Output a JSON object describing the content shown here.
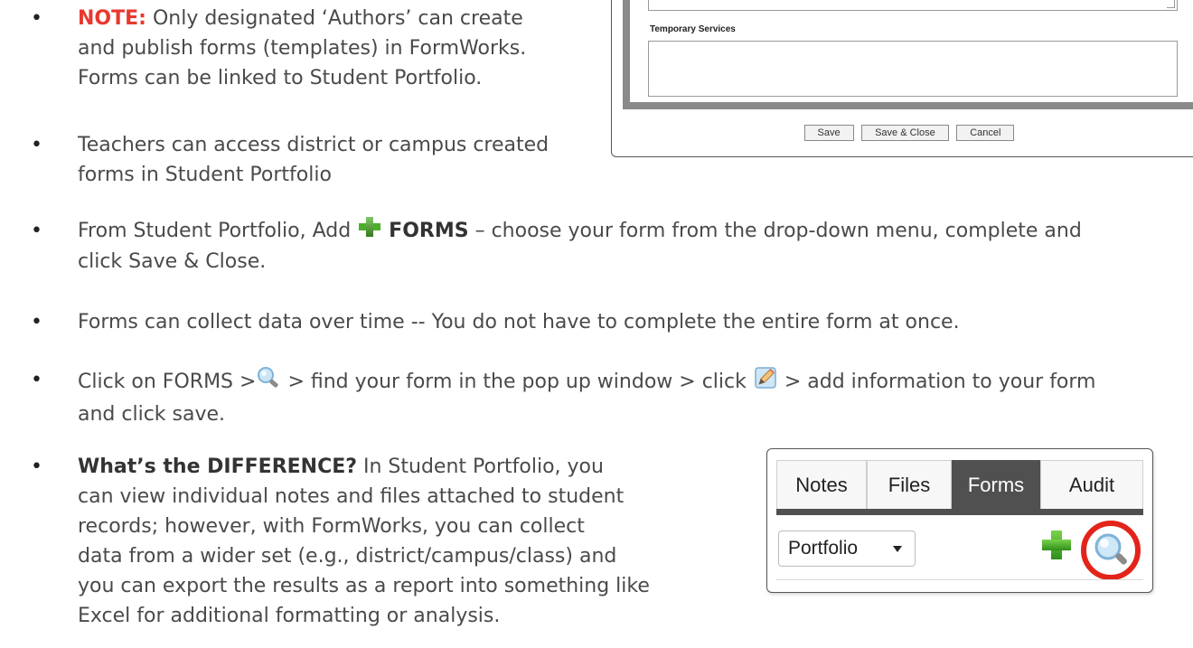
{
  "bullets": [
    {
      "id": "note",
      "bold_prefix": "NOTE:",
      "line1": " Only designated ‘Authors’ can create",
      "line2": "and publish forms (templates) in FormWorks.",
      "line3": "Forms can be linked to Student Portfolio."
    },
    {
      "id": "teachers",
      "line1": "Teachers can access district or campus created",
      "line2": "forms in Student Portfolio"
    },
    {
      "id": "add-forms",
      "pre": "From Student Portfolio, Add ",
      "bold": "FORMS",
      "post": "  – choose your form from the drop-down menu,  complete and",
      "line2": "click Save & Close."
    },
    {
      "id": "collect",
      "line1": "Forms can collect data over time -- You do not have to complete the entire form at once."
    },
    {
      "id": "click-forms",
      "pre": "Click on FORMS >",
      "mid": " > find your form in the pop up window > click ",
      "post": " > add information to your form",
      "line2": "and click save."
    },
    {
      "id": "difference",
      "bold_prefix": "What’s the DIFFERENCE?",
      "line1": " In Student Portfolio, you",
      "line2": "can view individual notes and files attached to student",
      "line3": "records; however, with FormWorks, you can collect",
      "line4": "data from a wider set (e.g., district/campus/class) and",
      "line5": "you can export the results as a report into something like",
      "line6": "Excel for additional formatting or analysis."
    }
  ],
  "form_screenshot": {
    "label": "Temporary Services",
    "buttons": [
      "Save",
      "Save & Close",
      "Cancel"
    ]
  },
  "tabs_screenshot": {
    "tabs": [
      "Notes",
      "Files",
      "Forms",
      "Audit"
    ],
    "active_tab": "Forms",
    "dropdown_value": "Portfolio"
  },
  "colors": {
    "note_red": "#e8392f",
    "plus_green": "#4caf2a",
    "highlight_circle": "#e3241b",
    "tab_active_bg": "#505050"
  },
  "icons": [
    "plus-icon",
    "magnifier-icon",
    "edit-icon"
  ]
}
